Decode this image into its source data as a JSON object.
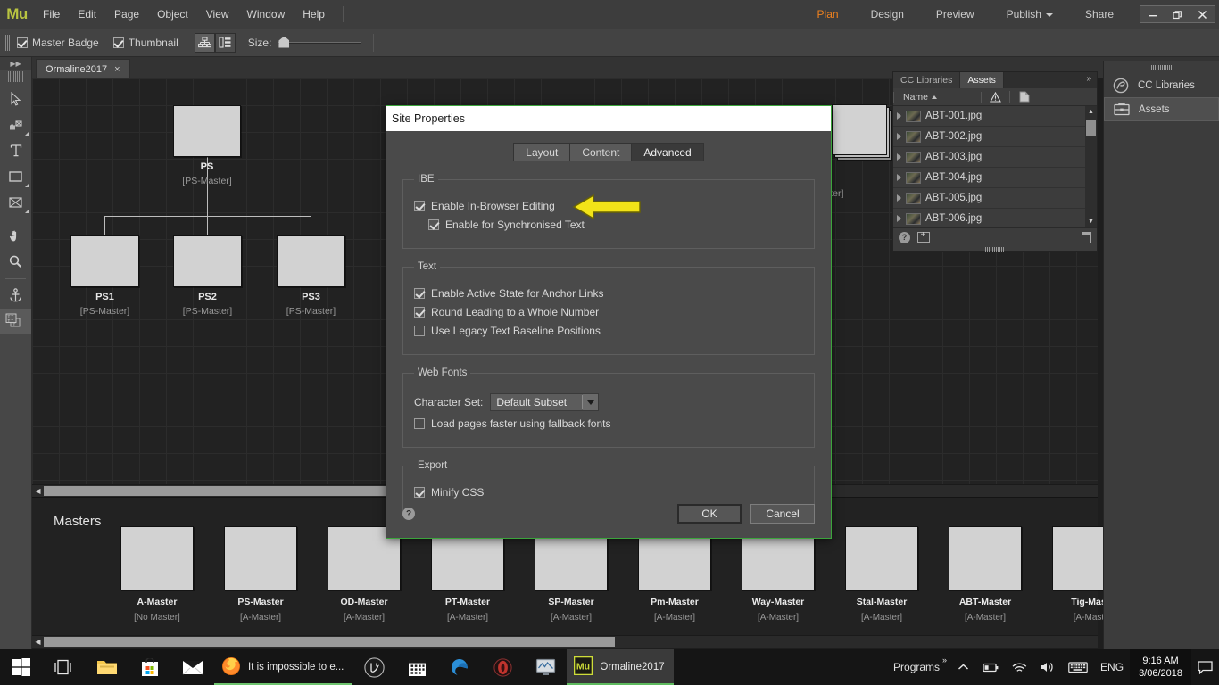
{
  "app": {
    "logo": "Mu",
    "title": "Ormaline2017"
  },
  "menubar": {
    "items": [
      "File",
      "Edit",
      "Page",
      "Object",
      "View",
      "Window",
      "Help"
    ],
    "modes": [
      {
        "label": "Plan",
        "active": true
      },
      {
        "label": "Design",
        "active": false
      },
      {
        "label": "Preview",
        "active": false
      },
      {
        "label": "Publish",
        "active": false,
        "has_caret": true
      },
      {
        "label": "Share",
        "active": false
      }
    ],
    "window_buttons": {
      "minimize": "—",
      "restore": "❐",
      "close": "✕"
    },
    "accent_color": "#f0821e"
  },
  "controlbar": {
    "master_badge_label": "Master Badge",
    "master_badge_checked": true,
    "thumbnail_label": "Thumbnail",
    "thumbnail_checked": true,
    "size_label": "Size:"
  },
  "toolbar": {
    "tools": [
      "selection-tool",
      "crop-tool",
      "text-tool",
      "rectangle-tool",
      "image-frame-tool",
      "hand-tool",
      "zoom-tool",
      "anchor-tool",
      "text-style-tool"
    ]
  },
  "doc_tab": {
    "label": "Ormaline2017",
    "close": "×"
  },
  "plan": {
    "home": {
      "name": "PS",
      "master": "[PS-Master]"
    },
    "children": [
      {
        "name": "PS1",
        "master": "[PS-Master]"
      },
      {
        "name": "PS2",
        "master": "[PS-Master]"
      },
      {
        "name": "PS3",
        "master": "[PS-Master]"
      }
    ],
    "hidden_page_master": "ster]"
  },
  "masters": {
    "title": "Masters",
    "items": [
      {
        "name": "A-Master",
        "parent": "[No Master]"
      },
      {
        "name": "PS-Master",
        "parent": "[A-Master]"
      },
      {
        "name": "OD-Master",
        "parent": "[A-Master]"
      },
      {
        "name": "PT-Master",
        "parent": "[A-Master]"
      },
      {
        "name": "SP-Master",
        "parent": "[A-Master]"
      },
      {
        "name": "Pm-Master",
        "parent": "[A-Master]"
      },
      {
        "name": "Way-Master",
        "parent": "[A-Master]"
      },
      {
        "name": "Stal-Master",
        "parent": "[A-Master]"
      },
      {
        "name": "ABT-Master",
        "parent": "[A-Master]"
      },
      {
        "name": "Tig-Mas",
        "parent": "[A-Mast"
      }
    ]
  },
  "assets_panel": {
    "tabs": [
      {
        "label": "CC Libraries",
        "active": false
      },
      {
        "label": "Assets",
        "active": true
      }
    ],
    "expand_glyph": "»",
    "columns": {
      "name": "Name",
      "warning": "⚠",
      "file": "file-icon"
    },
    "rows": [
      {
        "name": "ABT-001.jpg"
      },
      {
        "name": "ABT-002.jpg"
      },
      {
        "name": "ABT-003.jpg"
      },
      {
        "name": "ABT-004.jpg"
      },
      {
        "name": "ABT-005.jpg"
      },
      {
        "name": "ABT-006.jpg"
      }
    ],
    "footer": {
      "help": "?",
      "add": "add-asset-icon",
      "delete": "trash-icon"
    }
  },
  "dock": {
    "items": [
      {
        "label": "CC Libraries",
        "icon": "cc-libraries-icon",
        "active": false
      },
      {
        "label": "Assets",
        "icon": "assets-briefcase-icon",
        "active": true
      }
    ]
  },
  "dialog": {
    "title": "Site Properties",
    "border_color": "#3ba43b",
    "tabs": [
      {
        "label": "Layout",
        "active": false
      },
      {
        "label": "Content",
        "active": false
      },
      {
        "label": "Advanced",
        "active": true
      }
    ],
    "groups": [
      {
        "legend": "IBE",
        "rows": [
          {
            "label": "Enable In-Browser Editing",
            "checked": true,
            "indent": false
          },
          {
            "label": "Enable for Synchronised Text",
            "checked": true,
            "indent": true
          }
        ]
      },
      {
        "legend": "Text",
        "rows": [
          {
            "label": "Enable Active State for Anchor Links",
            "checked": true,
            "indent": false
          },
          {
            "label": "Round Leading to a Whole Number",
            "checked": true,
            "indent": false
          },
          {
            "label": "Use Legacy Text Baseline Positions",
            "checked": false,
            "indent": false
          }
        ]
      },
      {
        "legend": "Web Fonts",
        "select_label": "Character Set:",
        "select_value": "Default Subset",
        "rows": [
          {
            "label": "Load pages faster using fallback fonts",
            "checked": false,
            "indent": false
          }
        ]
      },
      {
        "legend": "Export",
        "rows": [
          {
            "label": "Minify CSS",
            "checked": true,
            "indent": false
          }
        ]
      }
    ],
    "help_glyph": "?",
    "ok_label": "OK",
    "cancel_label": "Cancel",
    "annotation_arrow_color": "#f2e318"
  },
  "taskbar": {
    "apps": [
      {
        "label": "It is impossible to e...",
        "icon": "firefox-icon",
        "active": false
      },
      {
        "label": "Ormaline2017",
        "icon": "muse-icon",
        "active": true
      }
    ],
    "programs_label": "Programs",
    "programs_chevron": "»",
    "language": "ENG",
    "time": "9:16 AM",
    "date": "3/06/2018"
  }
}
